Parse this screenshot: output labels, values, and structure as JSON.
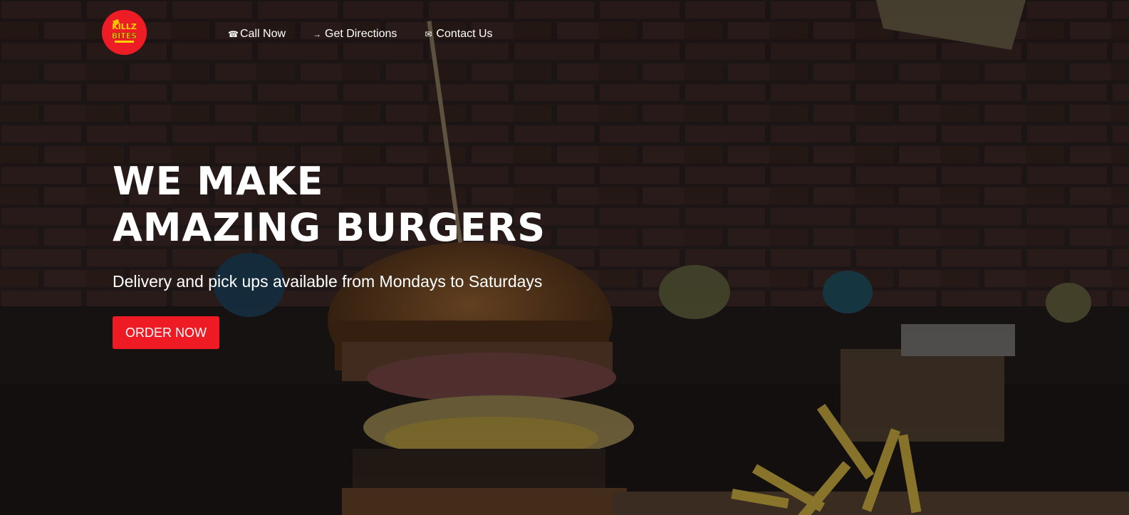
{
  "brand": {
    "logo_text_top": "KILLZ",
    "logo_text_bottom": "BITES",
    "accent_color": "#ee1b24"
  },
  "nav": {
    "items": [
      {
        "label": "Call Now",
        "icon": "phone-icon",
        "glyph": "☎"
      },
      {
        "label": "Get Directions",
        "icon": "arrow-right-icon",
        "glyph": "→"
      },
      {
        "label": "Contact Us",
        "icon": "envelope-icon",
        "glyph": "✉"
      }
    ]
  },
  "hero": {
    "headline_line1": "WE MAKE",
    "headline_line2": "AMAZING BURGERS",
    "subtitle": "Delivery and pick ups available from Mondays to Saturdays",
    "cta_label": "ORDER NOW",
    "background": "burger-and-fries-photo-dimmed"
  }
}
